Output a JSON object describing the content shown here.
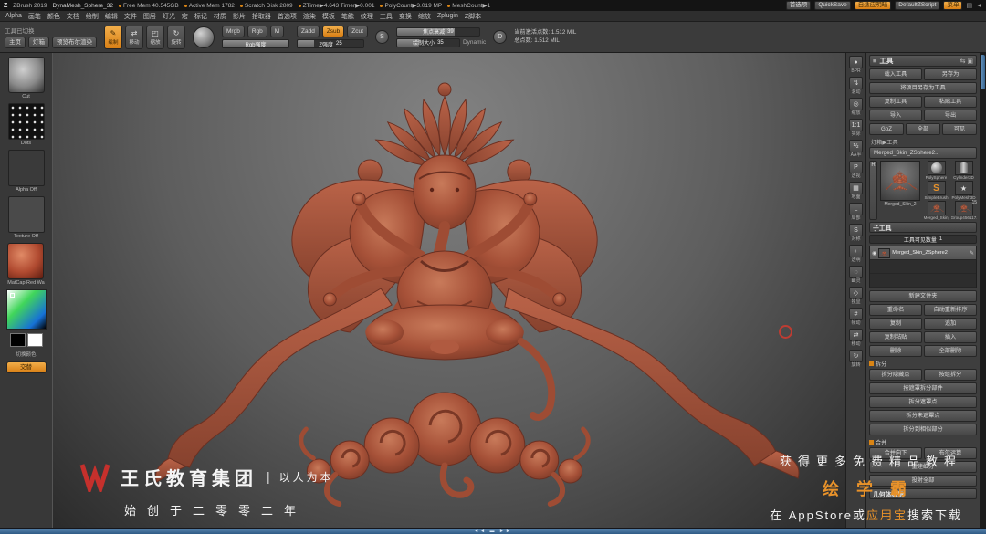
{
  "title_bar": {
    "app": "ZBrush 2019",
    "doc": "DynaMesh_Sphere_32",
    "stats": [
      "Free Mem 40.545GB",
      "Active Mem 1782",
      "Scratch Disk 2809",
      "ZTime▶4.643 Timer▶0.001",
      "PolyCount▶3.019 MP",
      "MeshCount▶1"
    ],
    "pref_label": "首选项",
    "quicksave_label": "QuickSave",
    "shade_label": "自适应明暗",
    "zscript_label": "DefaultZScript",
    "menu_label": "菜单",
    "win_icons": "▤",
    "back_icon": "◄"
  },
  "menu": {
    "items": [
      "Alpha",
      "画笔",
      "颜色",
      "文档",
      "绘制",
      "编辑",
      "文件",
      "图层",
      "灯光",
      "宏",
      "标记",
      "材质",
      "影片",
      "拾取器",
      "首选项",
      "渲染",
      "模板",
      "笔触",
      "纹理",
      "工具",
      "变换",
      "缩放",
      "Zplugin",
      "Z脚本"
    ]
  },
  "toolbar": {
    "status": "工具已切换",
    "home_btn": "主页",
    "lightbox_btn": "灯箱",
    "boolean_btn": "预览布尔渲染",
    "edit_btn": "绘制",
    "move_btn": "移动",
    "scale_btn": "缩放",
    "rotate_btn": "旋转",
    "paint_modes": [
      "Mrgb",
      "Rgb",
      "M"
    ],
    "rgb_slider_label": "Rgb强度",
    "sculpt_modes": [
      "Zadd",
      "Zsub",
      "Zcut"
    ],
    "z_intensity_label": "Z强度",
    "z_intensity_value": "25",
    "focal_label": "焦点衰减",
    "focal_value": "39",
    "size_label": "绘制大小",
    "size_value": "35",
    "dynamic_label": "Dynamic",
    "s_indicator": "S",
    "d_indicator": "D",
    "active_points_label": "当前激活点数:",
    "active_points_value": "1.512 MIL",
    "total_points_label": "总点数:",
    "total_points_value": "1.512 MIL"
  },
  "left_tray": {
    "brush_label": "Cut",
    "stroke_label": "Dots",
    "alpha_label": "Alpha Off",
    "texture_label": "Texture Off",
    "material_label": "MatCap Red Wa",
    "switch_label": "切换颜色",
    "alt_label": "交替"
  },
  "right_shelf": {
    "items": [
      {
        "label": "BPR",
        "glyph": "●"
      },
      {
        "label": "滚动",
        "glyph": "⇅"
      },
      {
        "label": "缩放",
        "glyph": "◎"
      },
      {
        "label": "实际",
        "glyph": "1:1"
      },
      {
        "label": "AA半",
        "glyph": "½"
      },
      {
        "label": "透视",
        "glyph": "P"
      },
      {
        "label": "地面",
        "glyph": "▦"
      },
      {
        "label": "局部",
        "glyph": "L"
      },
      {
        "label": "对称",
        "glyph": "S"
      },
      {
        "label": "透明",
        "glyph": "◐"
      },
      {
        "label": "幽灵",
        "glyph": "◌"
      },
      {
        "label": "独显",
        "glyph": "◇"
      },
      {
        "label": "帧动",
        "glyph": "#"
      },
      {
        "label": "移动",
        "glyph": "⇄"
      },
      {
        "label": "旋转",
        "glyph": "↻"
      }
    ]
  },
  "tool_panel": {
    "title": "工具",
    "header_icons": "⇆ ▣",
    "load_btn": "载入工具",
    "saveas_btn": "另存为",
    "saveproject_btn": "将项目另存为工具",
    "copy_btn": "复制工具",
    "paste_btn": "粘贴工具",
    "import_btn": "导入",
    "export_btn": "导出",
    "goz_btn": "GoZ",
    "all_btn": "全部",
    "visible_btn": "可见",
    "lightbox_tool_label": "灯箱▶工具",
    "current_tool_name": "Merged_Skin_ZSphere2...",
    "r_btn": "R",
    "big_thumb_label": "Merged_Skin_2",
    "recent": [
      {
        "label": "PolySphere"
      },
      {
        "label": "Cylinder3D"
      },
      {
        "label": "SimpleBrush"
      },
      {
        "label": "PolyMesh3D"
      },
      {
        "label": "Merged_Skin_1"
      },
      {
        "label": "Group456117..."
      }
    ],
    "recent_badge": "15",
    "subtool": {
      "title": "子工具",
      "count_label": "工具可见数量",
      "count_value": "1",
      "list_item": "Merged_Skin_ZSphere2",
      "folder_btn": "新建文件夹",
      "rows": [
        [
          "重命名",
          "自动重新排序"
        ],
        [
          "复制",
          "追加"
        ],
        [
          "复制粘贴",
          "插入"
        ],
        [
          "删除",
          "全部删除"
        ]
      ],
      "split_title": "拆分",
      "split_rows_a": [
        "拆分隐藏点",
        "按组拆分"
      ],
      "split_rows_wide": [
        "按遮罩拆分部件",
        "拆分遮罩点",
        "拆分未遮罩点",
        "拆分到相似部分"
      ],
      "merge_title": "合并",
      "merge_rows_a": [
        "合并向下",
        "布尔运算"
      ],
      "merge_rows_wide": [
        "重建细分",
        "投射全部"
      ]
    },
    "geometry_title": "几何体编辑"
  },
  "watermark": {
    "logo": "W",
    "company": "王氏教育集团",
    "divider": "|",
    "slogan": "以人为本",
    "since": "始创于二零零二年",
    "promo_top": "获得更多免费精品教程",
    "promo_brand": "绘 学 霸",
    "promo_bottom_pre": "在 AppStore或",
    "promo_bottom_accent": "应用宝",
    "promo_bottom_post": "搜索下载"
  },
  "icons": {
    "eye": "◉",
    "pencil": "✎",
    "move": "⇄",
    "scale": "◰",
    "rotate": "↻",
    "menu": "≡",
    "star": "★"
  },
  "scrollbar_marks": "◄◄ ▬ ►►",
  "colors": {
    "accent_orange": "#e8922a",
    "sculpt_red": "#a65138",
    "canvas_top": "#828282",
    "canvas_bottom": "#2b2b2b"
  }
}
